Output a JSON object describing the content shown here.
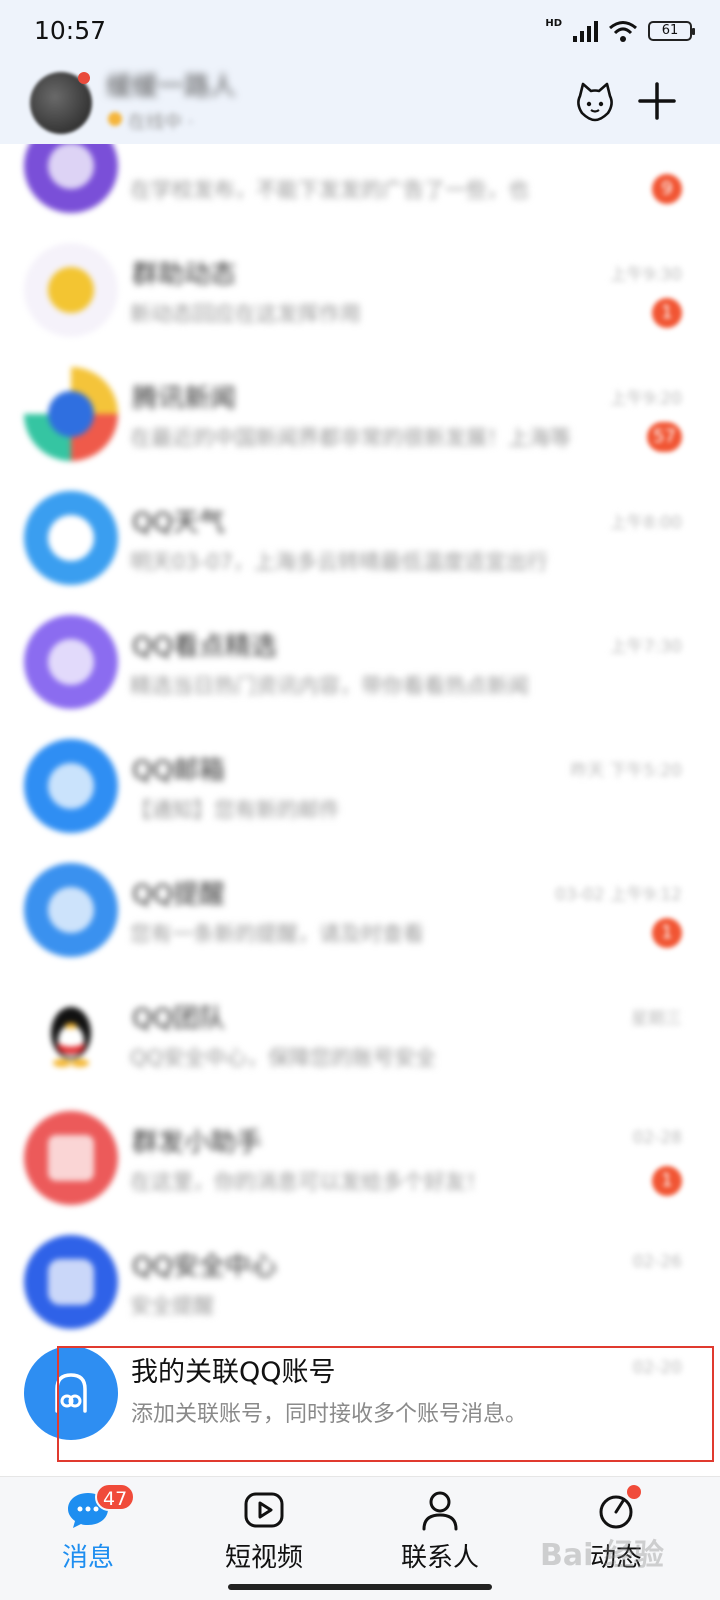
{
  "status_bar": {
    "time": "10:57",
    "network_label": "HD",
    "battery": "61"
  },
  "header": {
    "nickname": "缓缓一路人",
    "status_text": "在线中 ·"
  },
  "chats": [
    {
      "name": "",
      "preview": "在学校发布，不能下发发的广告了一些，也",
      "time": "",
      "badge": "9",
      "avatar_color": "#7a4fd8"
    },
    {
      "name": "群助动态",
      "preview": "新动态回应在这发挥作用",
      "time": "上午9:30",
      "badge": "1",
      "avatar_color": "#f3c532"
    },
    {
      "name": "腾讯新闻",
      "preview": "在最近的中国新闻界都非常的很新发展！上海等",
      "time": "上午9:20",
      "badge": "57",
      "avatar_color": "#2f6fe0"
    },
    {
      "name": "QQ天气",
      "preview": "明天03-07，上海多云转晴最低温度适宜出行",
      "time": "上午8:00",
      "badge": "",
      "avatar_color": "#3a9ef0"
    },
    {
      "name": "QQ看点精选",
      "preview": "精选当日热门资讯内容，带你看看热点新闻",
      "time": "上午7:30",
      "badge": "",
      "avatar_color": "#8b6cf0"
    },
    {
      "name": "QQ邮箱",
      "preview": "【通知】您有新的邮件",
      "time": "昨天 下午5:20",
      "badge": "",
      "avatar_color": "#2f8ef3"
    },
    {
      "name": "QQ提醒",
      "preview": "您有一条新的提醒，请及时查看",
      "time": "03-02 上午9:12",
      "badge": "1",
      "avatar_color": "#3a91ef"
    },
    {
      "name": "QQ团队",
      "preview": "QQ安全中心，保障您的账号安全",
      "time": "星期三",
      "badge": "",
      "avatar_color": "#f0f0f0"
    },
    {
      "name": "群发小助手",
      "preview": "在这里，你的消息可以发给多个好友！",
      "time": "02-28",
      "badge": "1",
      "avatar_color": "#ec5a5a"
    },
    {
      "name": "QQ安全中心",
      "preview": "安全提醒",
      "time": "02-26",
      "badge": "",
      "avatar_color": "#2f62e8"
    }
  ],
  "linked_account": {
    "name": "我的关联QQ账号",
    "preview": "添加关联账号，同时接收多个账号消息。",
    "time": "02-20"
  },
  "nav": {
    "messages": "消息",
    "messages_badge": "47",
    "videos": "短视频",
    "contacts": "联系人",
    "moments": "动态"
  },
  "watermark": "Bai 经验",
  "colors": {
    "accent": "#1e8ef0",
    "badge": "#f04b3a",
    "highlight": "#e03a2f"
  }
}
